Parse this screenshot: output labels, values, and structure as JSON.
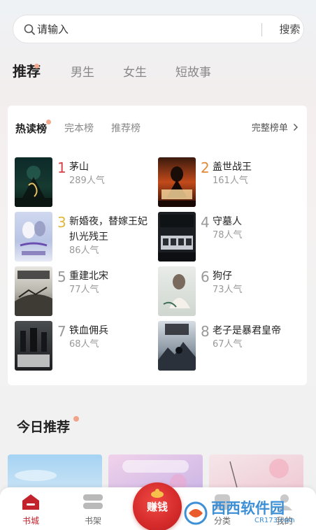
{
  "search": {
    "placeholder": "请输入",
    "button_label": "搜索"
  },
  "tabs": [
    {
      "label": "推荐",
      "active": true
    },
    {
      "label": "男生",
      "active": false
    },
    {
      "label": "女生",
      "active": false
    },
    {
      "label": "短故事",
      "active": false
    }
  ],
  "ranking": {
    "subtabs": [
      {
        "label": "热读榜",
        "active": true
      },
      {
        "label": "完本榜",
        "active": false
      },
      {
        "label": "推荐榜",
        "active": false
      }
    ],
    "full_label": "完整榜单",
    "rank_colors": {
      "1": "#d9414a",
      "2": "#e08a3a",
      "3": "#e0b83a",
      "default": "#999999"
    },
    "books": [
      {
        "rank": "1",
        "title": "茅山",
        "popularity": "289人气"
      },
      {
        "rank": "2",
        "title": "盖世战王",
        "popularity": "161人气"
      },
      {
        "rank": "3",
        "title": "新婚夜，替嫁王妃扒光残王",
        "popularity": "86人气"
      },
      {
        "rank": "4",
        "title": "守墓人",
        "popularity": "78人气"
      },
      {
        "rank": "5",
        "title": "重建北宋",
        "popularity": "77人气"
      },
      {
        "rank": "6",
        "title": "狗仔",
        "popularity": "73人气"
      },
      {
        "rank": "7",
        "title": "铁血佣兵",
        "popularity": "68人气"
      },
      {
        "rank": "8",
        "title": "老子是暴君皇帝",
        "popularity": "67人气"
      }
    ]
  },
  "today": {
    "title": "今日推荐"
  },
  "nav": {
    "items": [
      {
        "label": "书城",
        "icon": "home-icon",
        "active": true
      },
      {
        "label": "书架",
        "icon": "bookshelf-icon",
        "active": false
      },
      {
        "label": "分类",
        "icon": "category-icon",
        "active": false
      },
      {
        "label": "我的",
        "icon": "profile-icon",
        "active": false
      }
    ],
    "earn_label": "赚钱"
  },
  "watermark": {
    "text": "西西软件园",
    "domain": "CR173.com"
  },
  "colors": {
    "accent": "#c1222b",
    "earn": "#d42a2a",
    "watermark": "#3d8fd6"
  }
}
